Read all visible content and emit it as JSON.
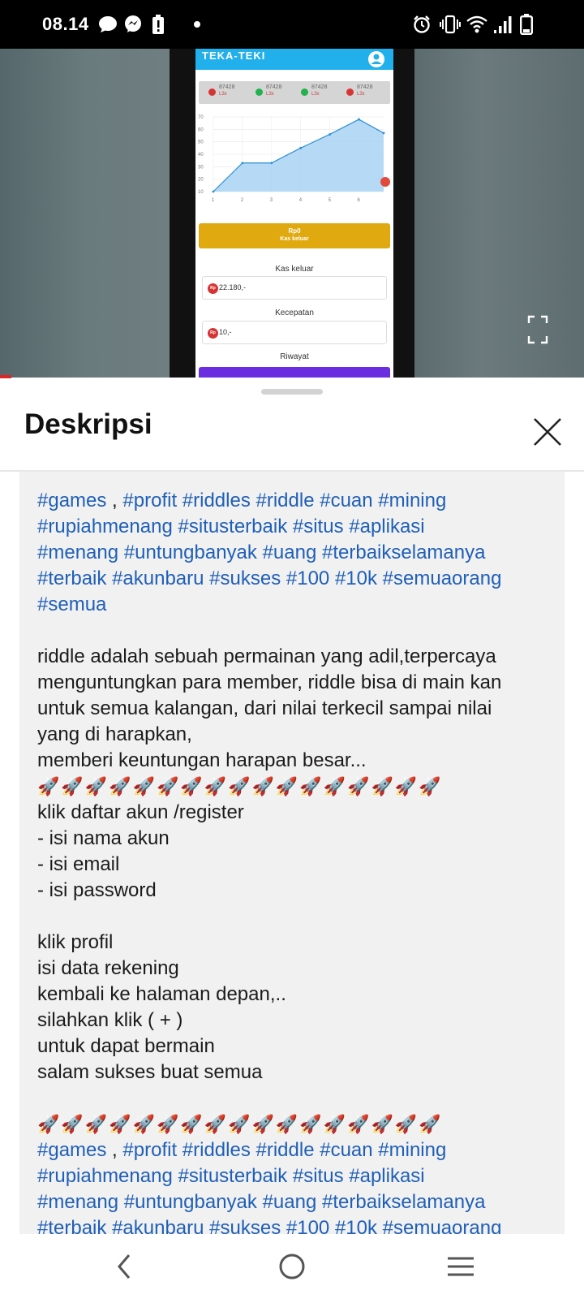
{
  "status_bar": {
    "time": "08.14",
    "left_icons": [
      "chat-bubble-icon",
      "messenger-icon",
      "battery-alert-icon",
      "dot-icon"
    ],
    "right_icons": [
      "alarm-icon",
      "vibrate-icon",
      "wifi-icon",
      "signal-icon",
      "battery-icon"
    ]
  },
  "video": {
    "app": {
      "title": "TEKA-TEKI",
      "ticker": [
        {
          "value": "87428",
          "sub": "L3x",
          "color": "#d63434"
        },
        {
          "value": "87428",
          "sub": "L3x",
          "color": "#22b14c"
        },
        {
          "value": "87428",
          "sub": "L3x",
          "color": "#22b14c"
        },
        {
          "value": "87428",
          "sub": "L3x",
          "color": "#d63434"
        }
      ],
      "cash_button": {
        "amount": "Rp0",
        "label": "Kas keluar"
      },
      "fields": [
        {
          "label": "Kas keluar",
          "value": "22.180,-"
        },
        {
          "label": "Kecepatan",
          "value": "10,-"
        }
      ],
      "history_label": "Riwayat",
      "currency_badge": "Rp"
    },
    "fullscreen_icon": "fullscreen-icon"
  },
  "chart_data": {
    "type": "area",
    "x": [
      1,
      2,
      3,
      4,
      5,
      6,
      6.85
    ],
    "y": [
      10,
      33,
      33,
      45,
      56,
      68,
      57
    ],
    "x_ticks": [
      "1",
      "2",
      "3",
      "4",
      "5",
      "6"
    ],
    "y_ticks": [
      "10",
      "20",
      "30",
      "40",
      "50",
      "60",
      "70"
    ],
    "xlim": [
      1,
      6.85
    ],
    "ylim": [
      10,
      70
    ],
    "fill_color": "#a9d4f5",
    "line_color": "#2b8fd6",
    "grid": true
  },
  "sheet": {
    "title": "Deskripsi",
    "close_icon": "close-icon",
    "description": {
      "hashtags_top": [
        [
          {
            "t": "#games",
            "tag": true
          },
          {
            "t": " , ",
            "tag": false
          },
          {
            "t": "#profit",
            "tag": true
          },
          {
            "t": " ",
            "tag": false
          },
          {
            "t": "#riddles",
            "tag": true
          },
          {
            "t": " ",
            "tag": false
          },
          {
            "t": "#riddle",
            "tag": true
          },
          {
            "t": " ",
            "tag": false
          },
          {
            "t": "#cuan",
            "tag": true
          },
          {
            "t": " ",
            "tag": false
          },
          {
            "t": "#mining",
            "tag": true
          }
        ],
        [
          {
            "t": "#rupiahmenang",
            "tag": true
          },
          {
            "t": " ",
            "tag": false
          },
          {
            "t": "#situsterbaik",
            "tag": true
          },
          {
            "t": " ",
            "tag": false
          },
          {
            "t": "#situs",
            "tag": true
          },
          {
            "t": " ",
            "tag": false
          },
          {
            "t": "#aplikasi",
            "tag": true
          }
        ],
        [
          {
            "t": "#menang",
            "tag": true
          },
          {
            "t": " ",
            "tag": false
          },
          {
            "t": "#untungbanyak",
            "tag": true
          },
          {
            "t": " ",
            "tag": false
          },
          {
            "t": "#uang",
            "tag": true
          },
          {
            "t": " ",
            "tag": false
          },
          {
            "t": "#terbaikselamanya",
            "tag": true
          }
        ],
        [
          {
            "t": "#terbaik",
            "tag": true
          },
          {
            "t": " ",
            "tag": false
          },
          {
            "t": "#akunbaru",
            "tag": true
          },
          {
            "t": " ",
            "tag": false
          },
          {
            "t": "#sukses",
            "tag": true
          },
          {
            "t": " ",
            "tag": false
          },
          {
            "t": "#100",
            "tag": true
          },
          {
            "t": " ",
            "tag": false
          },
          {
            "t": "#10k",
            "tag": true
          },
          {
            "t": " ",
            "tag": false
          },
          {
            "t": "#semuaorang",
            "tag": true
          }
        ],
        [
          {
            "t": "#semua",
            "tag": true
          }
        ]
      ],
      "body_lines_1": [
        "riddle adalah sebuah permainan yang adil,terpercaya",
        "menguntungkan para member, riddle bisa di main kan",
        "untuk semua kalangan, dari nilai terkecil sampai nilai",
        "yang di harapkan,",
        "memberi keuntungan harapan besar..."
      ],
      "rocket_row": "🚀🚀🚀🚀🚀🚀🚀🚀🚀🚀🚀🚀🚀🚀🚀🚀🚀",
      "body_lines_2": [
        "klik daftar akun /register",
        "- isi nama akun",
        "- isi email",
        "- isi password"
      ],
      "body_lines_3": [
        "klik profil",
        "isi data rekening",
        "kembali ke halaman depan,..",
        "silahkan klik ( + )",
        "untuk dapat bermain",
        "salam sukses buat semua"
      ]
    }
  },
  "nav_bar": {
    "buttons": [
      "back-icon",
      "home-icon",
      "recents-icon"
    ]
  }
}
